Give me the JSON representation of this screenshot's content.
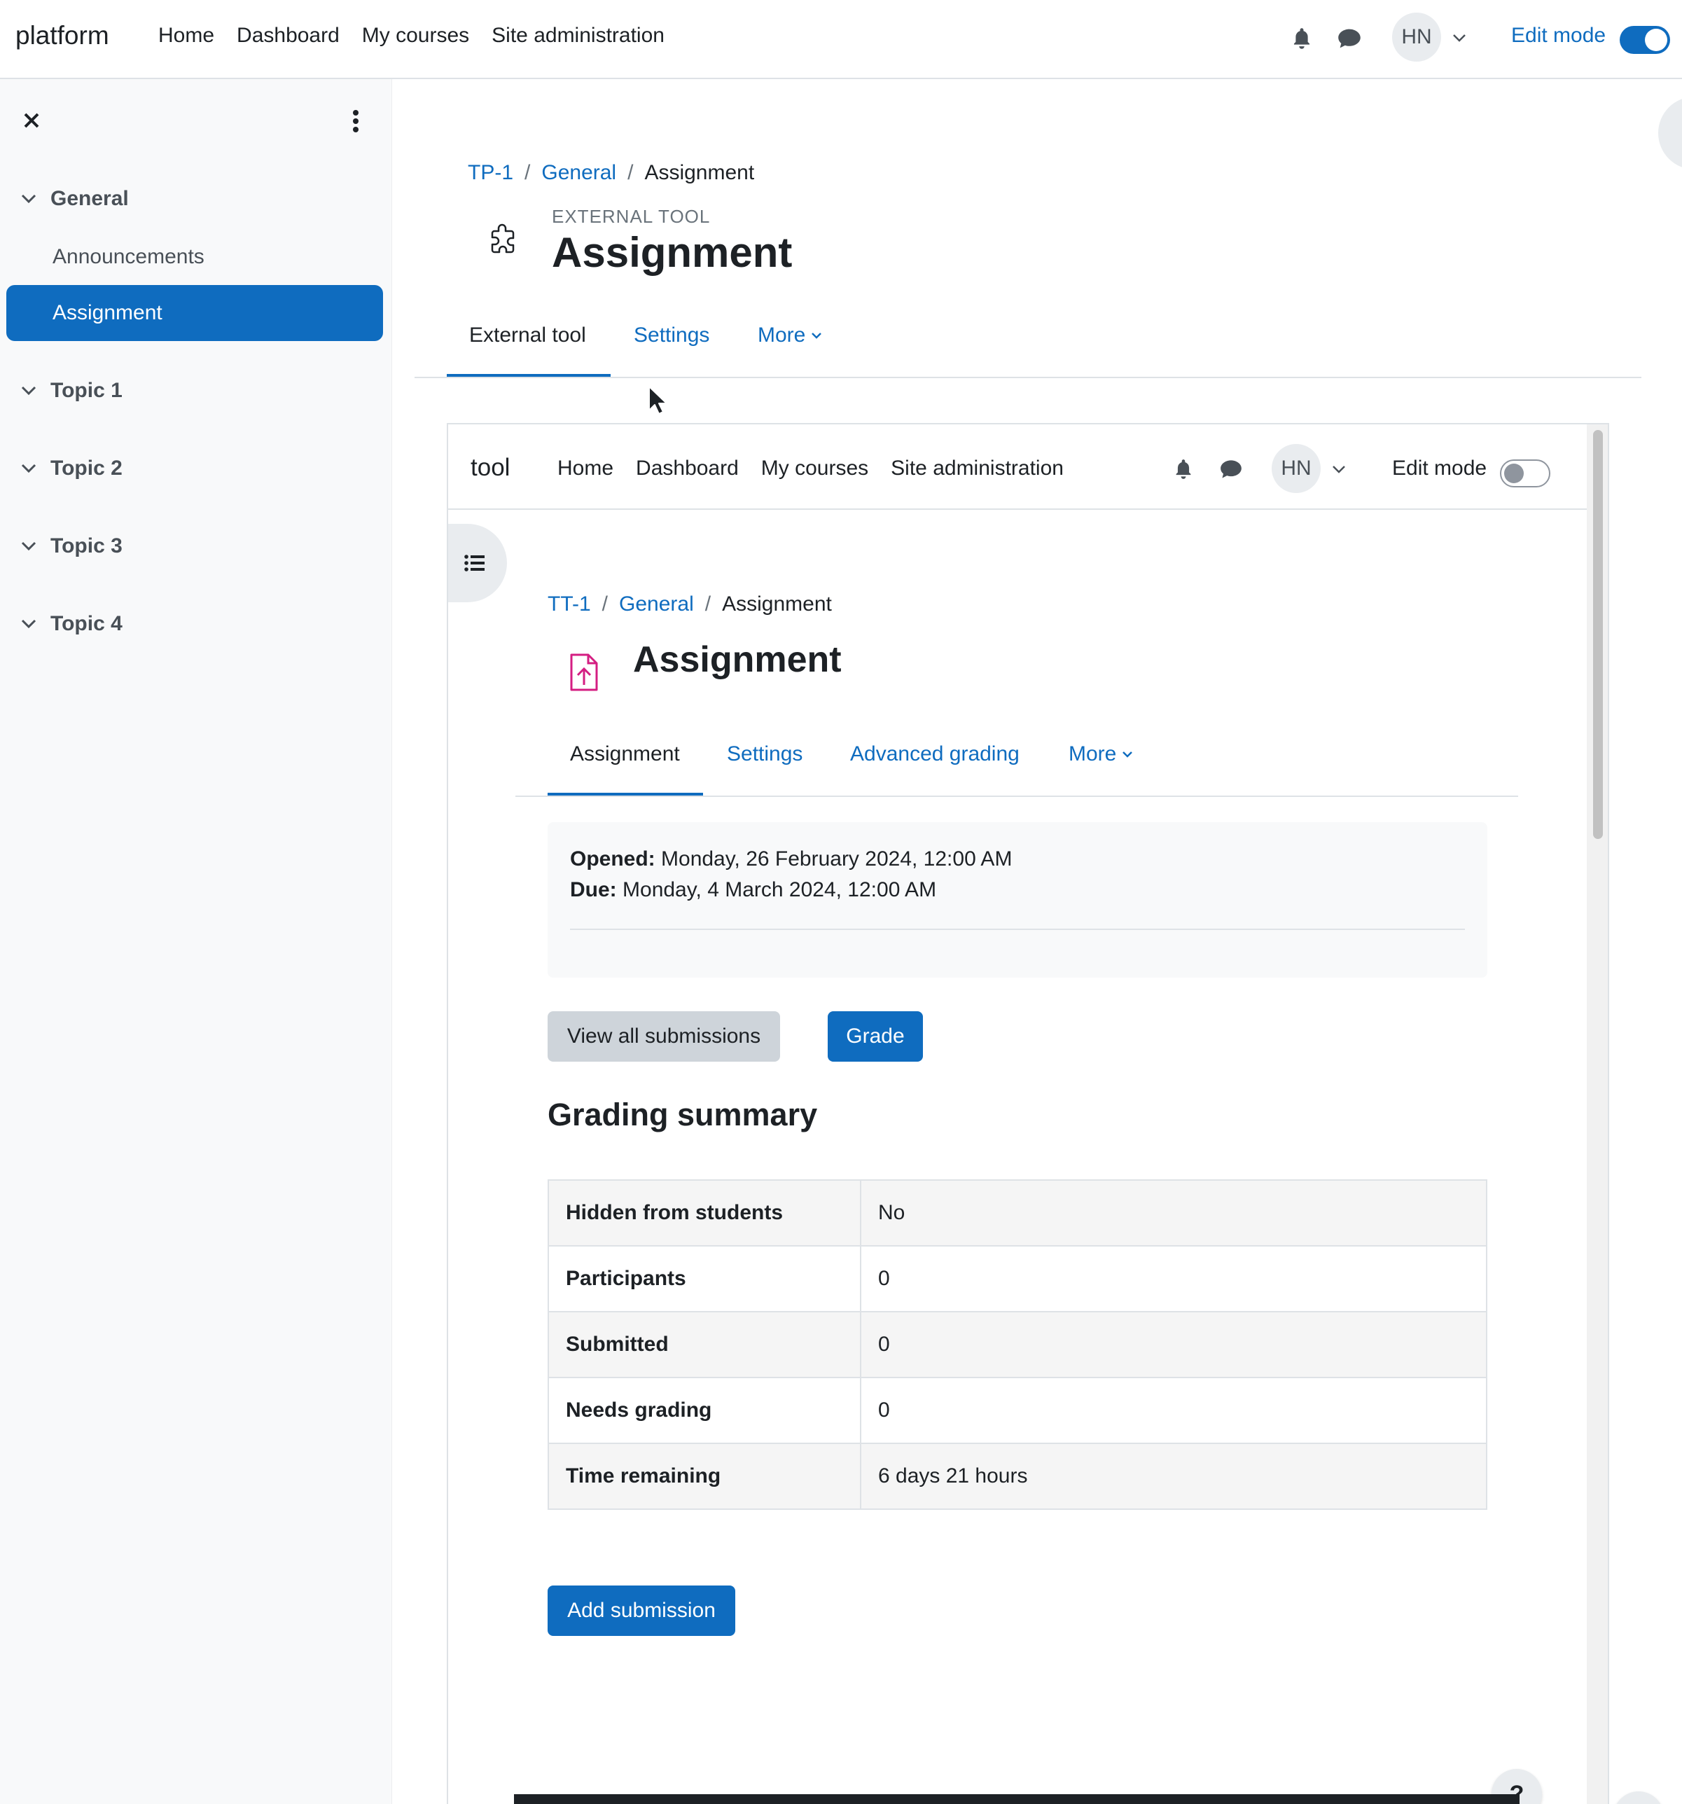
{
  "outer_nav": {
    "brand": "platform",
    "links": [
      "Home",
      "Dashboard",
      "My courses",
      "Site administration"
    ],
    "avatar_initials": "HN",
    "edit_mode_label": "Edit mode",
    "edit_mode_on": true
  },
  "drawer": {
    "sections": [
      {
        "title": "General",
        "items": [
          "Announcements",
          "Assignment"
        ]
      },
      {
        "title": "Topic 1"
      },
      {
        "title": "Topic 2"
      },
      {
        "title": "Topic 3"
      },
      {
        "title": "Topic 4"
      }
    ],
    "active_item": "Assignment"
  },
  "outer_page": {
    "breadcrumb": [
      "TP-1",
      "General",
      "Assignment"
    ],
    "overline": "EXTERNAL TOOL",
    "title": "Assignment",
    "tabs": [
      "External tool",
      "Settings",
      "More"
    ]
  },
  "frame": {
    "nav": {
      "brand": "tool",
      "links": [
        "Home",
        "Dashboard",
        "My courses",
        "Site administration"
      ],
      "avatar_initials": "HN",
      "edit_mode_label": "Edit mode",
      "edit_mode_on": false
    },
    "breadcrumb": [
      "TT-1",
      "General",
      "Assignment"
    ],
    "title": "Assignment",
    "tabs": [
      "Assignment",
      "Settings",
      "Advanced grading",
      "More"
    ],
    "dates": {
      "opened_label": "Opened:",
      "opened_value": "Monday, 26 February 2024, 12:00 AM",
      "due_label": "Due:",
      "due_value": "Monday, 4 March 2024, 12:00 AM"
    },
    "buttons": {
      "view_all": "View all submissions",
      "grade": "Grade",
      "add_submission": "Add submission"
    },
    "grading_summary": {
      "heading": "Grading summary",
      "rows": [
        {
          "label": "Hidden from students",
          "value": "No"
        },
        {
          "label": "Participants",
          "value": "0"
        },
        {
          "label": "Submitted",
          "value": "0"
        },
        {
          "label": "Needs grading",
          "value": "0"
        },
        {
          "label": "Time remaining",
          "value": "6 days 21 hours"
        }
      ]
    },
    "help_label": "?"
  },
  "page_help_label": "?",
  "colors": {
    "accent": "#0f6cbf",
    "drawer_bg": "#f8f9fa",
    "mod_icon": "#d41e82"
  }
}
